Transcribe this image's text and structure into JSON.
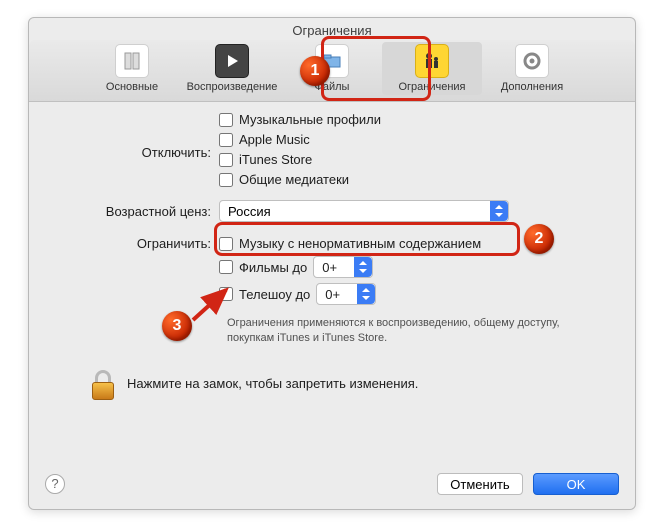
{
  "title": "Ограничения",
  "tabs": {
    "general": "Основные",
    "playback": "Воспроизведение",
    "files": "Файлы",
    "restrictions": "Ограничения",
    "addons": "Дополнения"
  },
  "disable": {
    "label": "Отключить:",
    "music_profiles": "Музыкальные профили",
    "apple_music": "Apple Music",
    "itunes_store": "iTunes Store",
    "shared_libs": "Общие медиатеки"
  },
  "age_rating": {
    "label": "Возрастной ценз:",
    "value": "Россия"
  },
  "restrict": {
    "label": "Ограничить:",
    "explicit_music": "Музыку с ненормативным содержанием",
    "movies_to": "Фильмы до",
    "tvshows_to": "Телешоу до",
    "movies_val": "0+",
    "tv_val": "0+",
    "note": "Ограничения применяются к воспроизведению, общему доступу, покупкам iTunes и iTunes Store."
  },
  "lock_text": "Нажмите на замок, чтобы запретить изменения.",
  "buttons": {
    "help": "?",
    "cancel": "Отменить",
    "ok": "OK"
  },
  "callouts": {
    "c1": "1",
    "c2": "2",
    "c3": "3"
  }
}
